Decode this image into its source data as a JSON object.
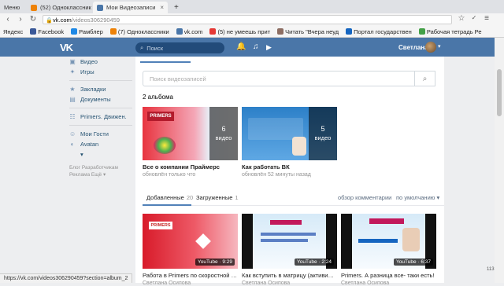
{
  "browser": {
    "tabs": [
      {
        "label": "Меню",
        "color": "#999999"
      },
      {
        "label": "(52) Одноклассники",
        "color": "#ee8208"
      },
      {
        "label": "Мои Видеозаписи",
        "color": "#4a76a8"
      }
    ],
    "new_tab": "+",
    "url_host": "vk.com",
    "url_path": "/videos306290459",
    "bookmarks": [
      {
        "label": "Яндекс",
        "color": "#ffffff"
      },
      {
        "label": "Facebook",
        "color": "#3b5998"
      },
      {
        "label": "Рамблер",
        "color": "#1e88e5"
      },
      {
        "label": "(7) Одноклассники",
        "color": "#ee8208"
      },
      {
        "label": "vk.com",
        "color": "#4a76a8"
      },
      {
        "label": "(5) не умеешь прит",
        "color": "#e53935"
      },
      {
        "label": "Читать \"Вчера неуд",
        "color": "#8d6e63"
      },
      {
        "label": "Портал государствен",
        "color": "#1565c0"
      },
      {
        "label": "Рабочая тетрадь Ре",
        "color": "#43a047"
      }
    ],
    "status_url": "https://vk.com/videos306290459?section=album_2",
    "page_count": "113"
  },
  "vk": {
    "logo": "VK",
    "search_placeholder": "Поиск",
    "user_name": "Светлана",
    "brand_color": "#4a76a8"
  },
  "sidebar": {
    "items": [
      {
        "label": "Видео",
        "icon": "video-icon"
      },
      {
        "label": "Игры",
        "icon": "games-icon"
      },
      {
        "label": "Закладки",
        "icon": "star-icon"
      },
      {
        "label": "Документы",
        "icon": "document-icon"
      },
      {
        "label": "Primers. Движен.",
        "icon": "group-icon"
      },
      {
        "label": "Мои Гости",
        "icon": "guests-icon"
      },
      {
        "label": "Avatan",
        "icon": "app-icon"
      },
      {
        "label": "▾",
        "icon": "more-icon"
      }
    ],
    "footer_line1": "Блог   Разработчикам",
    "footer_line2": "Реклама   Ещё ▾"
  },
  "main": {
    "search_placeholder": "Поиск видеозаписей",
    "albums_title": "2 альбома",
    "albums": [
      {
        "title": "Все о компании Праймерс",
        "subtitle": "обновлён только что",
        "count": "6",
        "count_label": "видео"
      },
      {
        "title": "Как работать ВК",
        "subtitle": "обновлён 52 минуты назад",
        "count": "5",
        "count_label": "видео"
      }
    ],
    "tabs": [
      {
        "label": "Добавленные",
        "count": "20"
      },
      {
        "label": "Загруженные",
        "count": "1"
      }
    ],
    "sort_comments": "обзор комментарии",
    "sort_default": "по умолчанию ▾",
    "videos": [
      {
        "title": "Работа в Primers по скоростной систем...",
        "author": "Светлана Осипова",
        "duration": "YouTube · 9:29"
      },
      {
        "title": "Как вступить в матрицу (активирование...",
        "author": "Светлана Осипова",
        "duration": "YouTube · 2:24"
      },
      {
        "title": "Primers. А разница все- таки есть!",
        "author": "Светлана Осипова",
        "duration": "YouTube · 6:37"
      }
    ]
  }
}
